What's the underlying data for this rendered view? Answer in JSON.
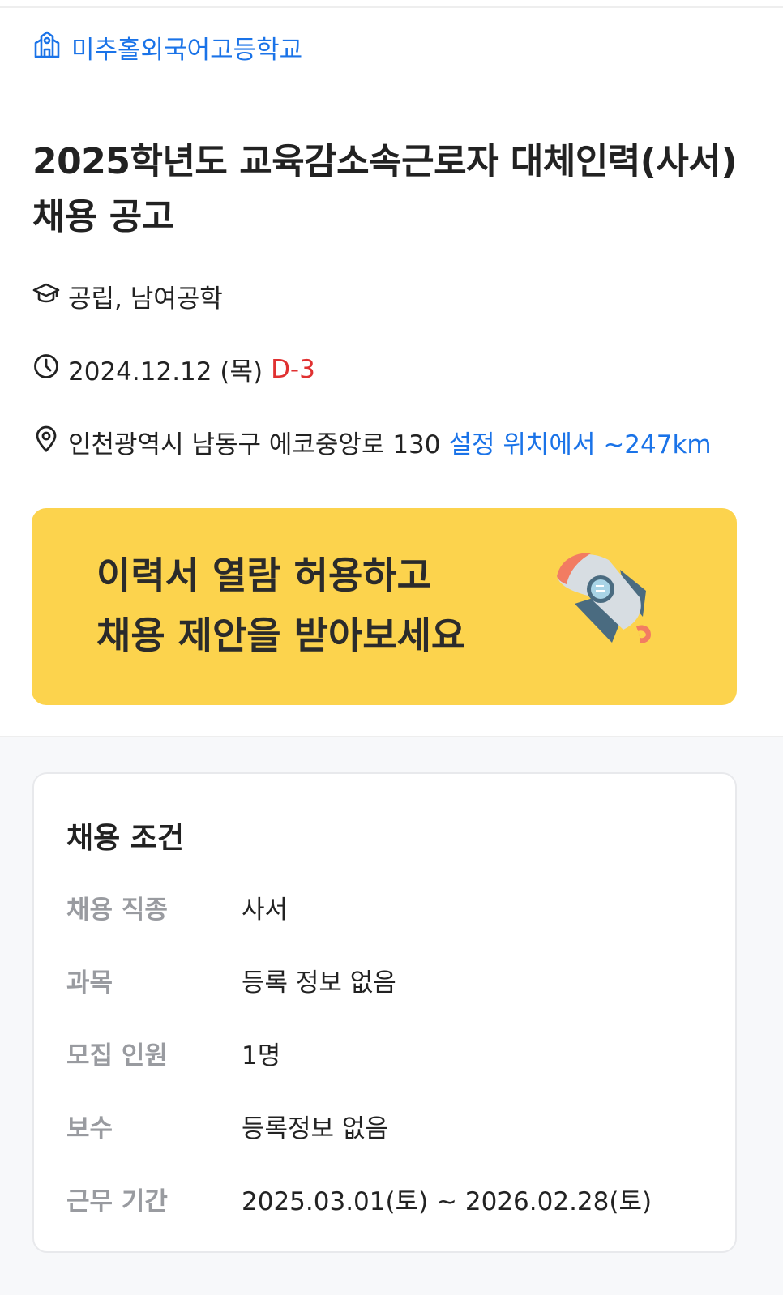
{
  "school": {
    "name": "미추홀외국어고등학교",
    "icon": "school-icon"
  },
  "title": "2025학년도 교육감소속근로자 대체인력(사서) 채용 공고",
  "meta": {
    "type": "공립, 남여공학",
    "deadline": "2024.12.12 (목)",
    "dday": "D-3",
    "address": "인천광역시 남동구 에코중앙로 130",
    "distance": "설정 위치에서 ~247km"
  },
  "banner": {
    "line1": "이력서 열람 허용하고",
    "line2": "채용 제안을 받아보세요",
    "bg_color": "#fcd34d"
  },
  "conditions": {
    "title": "채용 조건",
    "rows": [
      {
        "label": "채용 직종",
        "value": "사서"
      },
      {
        "label": "과목",
        "value": "등록 정보 없음"
      },
      {
        "label": "모집 인원",
        "value": "1명"
      },
      {
        "label": "보수",
        "value": "등록정보 없음"
      },
      {
        "label": "근무 기간",
        "value": "2025.03.01(토) ~ 2026.02.28(토)"
      }
    ]
  },
  "colors": {
    "accent": "#1a73e8",
    "dday": "#e03131",
    "label": "#999ba0"
  }
}
